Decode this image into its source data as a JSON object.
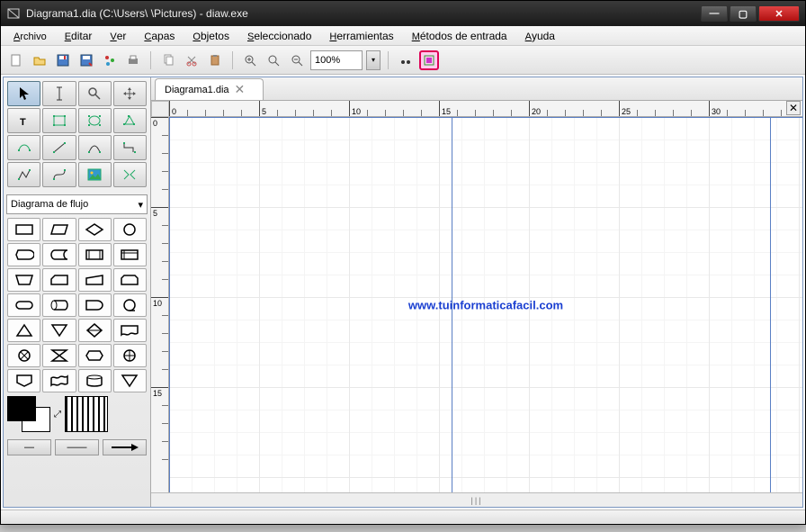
{
  "window": {
    "title": "Diagrama1.dia (C:\\Users\\        \\Pictures) - diaw.exe"
  },
  "menu": [
    "Archivo",
    "Editar",
    "Ver",
    "Capas",
    "Objetos",
    "Seleccionado",
    "Herramientas",
    "Métodos de entrada",
    "Ayuda"
  ],
  "toolbar": {
    "zoom": "100%"
  },
  "tab": {
    "label": "Diagrama1.dia"
  },
  "shape_category": "Diagrama de flujo",
  "ruler_h": [
    "0",
    "5",
    "10",
    "15",
    "20",
    "25",
    "30"
  ],
  "ruler_v": [
    "0",
    "5",
    "10",
    "15"
  ],
  "watermark": "www.tuinformaticafacil.com",
  "line_ends": {
    "start": "—",
    "mid": "——",
    "end": "→"
  }
}
